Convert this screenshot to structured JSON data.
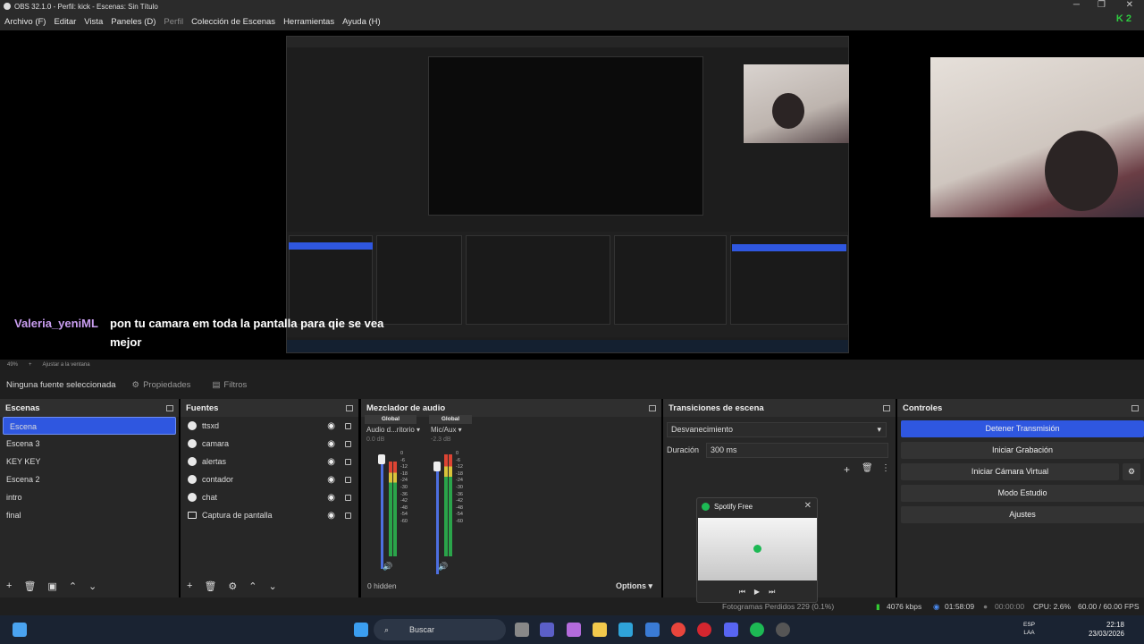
{
  "window": {
    "title": "OBS 32.1.0 - Perfil: kick - Escenas: Sin Título",
    "minimize": "─",
    "maximize": "❐",
    "close": "✕",
    "badge": "K 2"
  },
  "menu": [
    "Archivo (F)",
    "Editar",
    "Vista",
    "Paneles (D)",
    "Perfil",
    "Colección de Escenas",
    "Herramientas",
    "Ayuda (H)"
  ],
  "chat": {
    "user": "Valeria_yeniML",
    "message": "pon tu camara em toda la pantalla para qie se vea mejor"
  },
  "zoombar": {
    "zoom": "49%",
    "plus": "+",
    "fit": "Ajustar a la ventana"
  },
  "source_toolbar": {
    "none_selected": "Ninguna fuente seleccionada",
    "properties": "Propiedades",
    "filters": "Filtros"
  },
  "scenes": {
    "title": "Escenas",
    "items": [
      "Escena",
      "Escena 3",
      "KEY KEY",
      "Escena 2",
      "intro",
      "final"
    ],
    "selected": 0
  },
  "sources": {
    "title": "Fuentes",
    "items": [
      {
        "name": "ttsxd",
        "icon": "globe-icon"
      },
      {
        "name": "camara",
        "icon": "globe-icon"
      },
      {
        "name": "alertas",
        "icon": "globe-icon"
      },
      {
        "name": "contador",
        "icon": "globe-icon"
      },
      {
        "name": "chat",
        "icon": "globe-icon"
      },
      {
        "name": "Captura de pantalla",
        "icon": "monitor-icon"
      }
    ]
  },
  "mixer": {
    "title": "Mezclador de audio",
    "channels": [
      {
        "tag": "Global",
        "name": "Audio d...ritorio",
        "db": "0.0 dB"
      },
      {
        "tag": "Global",
        "name": "Mic/Aux",
        "db": "-2.3 dB"
      }
    ],
    "scale": [
      "0",
      "-6",
      "-12",
      "-18",
      "-24",
      "-30",
      "-36",
      "-42",
      "-48",
      "-54",
      "-60"
    ],
    "hidden": "0 hidden",
    "options": "Options"
  },
  "transitions": {
    "title": "Transiciones de escena",
    "selected": "Desvanecimiento",
    "duration_label": "Duración",
    "duration": "300 ms"
  },
  "controls": {
    "title": "Controles",
    "buttons": [
      "Detener Transmisión",
      "Iniciar Grabación",
      "Iniciar Cámara Virtual",
      "Modo Estudio",
      "Ajustes"
    ]
  },
  "spotify": {
    "title": "Spotify Free"
  },
  "status": {
    "frames": "Fotogramas Perdidos 229 (0.1%)",
    "bitrate": "4076 kbps",
    "stream_time": "01:58:09",
    "rec_time": "00:00:00",
    "cpu": "CPU: 2.6%",
    "fps": "60.00 / 60.00 FPS"
  },
  "taskbar": {
    "search": "Buscar",
    "lang1": "ESP",
    "lang2": "LAA",
    "time": "22:18",
    "date": "23/03/2026"
  }
}
